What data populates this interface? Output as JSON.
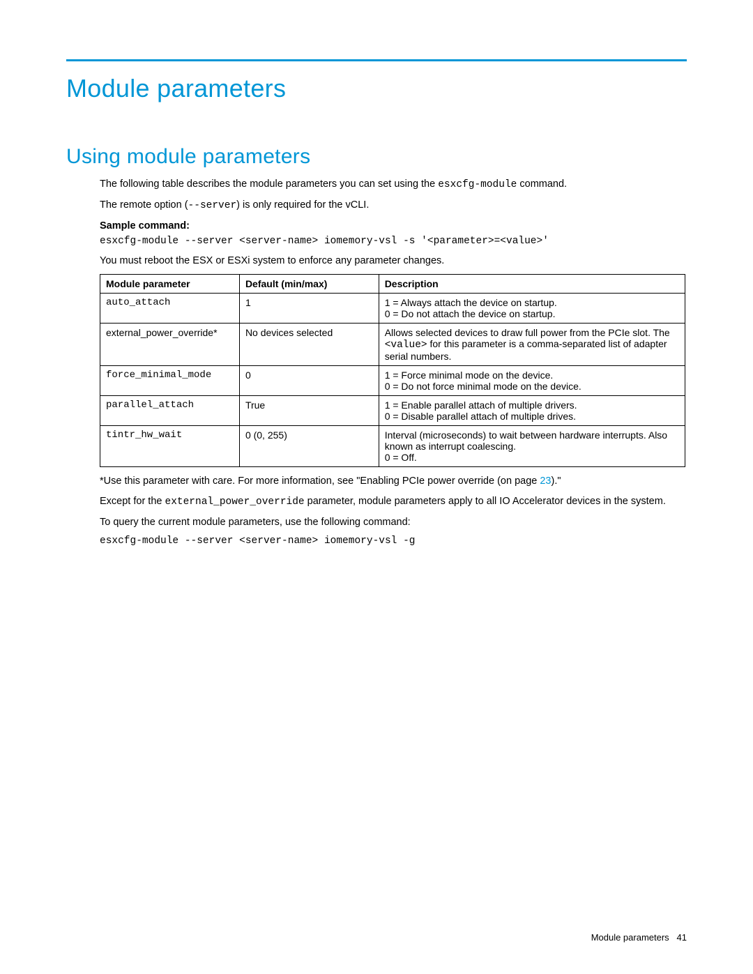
{
  "page_title": "Module parameters",
  "section_heading": "Using module parameters",
  "intro_text_1_pre": "The following table describes the module parameters you can set using the ",
  "intro_text_1_cmd": "esxcfg-module",
  "intro_text_1_post": " command.",
  "intro_text_2_pre": "The remote option (",
  "intro_text_2_cmd": "--server",
  "intro_text_2_post": ") is only required for the vCLI.",
  "sample_label": "Sample command:",
  "sample_cmd": "esxcfg-module --server <server-name> iomemory-vsl -s '<parameter>=<value>'",
  "reboot_note": "You must reboot the ESX or ESXi system to enforce any parameter changes.",
  "table": {
    "headers": {
      "param": "Module parameter",
      "default": "Default (min/max)",
      "desc": "Description"
    },
    "rows": [
      {
        "param": "auto_attach",
        "param_mono": true,
        "default": "1",
        "desc_lines": [
          "1 = Always attach the device on startup.",
          "0 = Do not attach the device on startup."
        ]
      },
      {
        "param": "external_power_override*",
        "param_mono": false,
        "default": "No devices selected",
        "desc_lines_html": "Allows selected devices to draw full power from the PCIe slot. The <span class=\"mono\">&lt;value&gt;</span> for this parameter is a comma-separated list of adapter serial numbers."
      },
      {
        "param": "force_minimal_mode",
        "param_mono": true,
        "default": "0",
        "desc_lines": [
          "1 = Force minimal mode on the device.",
          "0 = Do not force minimal mode on the device."
        ]
      },
      {
        "param": "parallel_attach",
        "param_mono": true,
        "default": "True",
        "desc_lines": [
          "1 = Enable parallel attach of multiple drivers.",
          "0 = Disable parallel attach of multiple drives."
        ]
      },
      {
        "param": "tintr_hw_wait",
        "param_mono": true,
        "default": "0 (0, 255)",
        "desc_lines": [
          "Interval (microseconds) to wait between hardware interrupts. Also known as interrupt coalescing.",
          "0 = Off."
        ]
      }
    ]
  },
  "footnote_pre": "*Use this parameter with care. For more information, see \"Enabling PCIe power override (on page ",
  "footnote_link": "23",
  "footnote_post": ").\"",
  "except_text_pre": "Except for the ",
  "except_text_cmd": "external_power_override",
  "except_text_post": " parameter, module parameters apply to all IO Accelerator devices in the system.",
  "query_text": "To query the current module parameters, use the following command:",
  "query_cmd": "esxcfg-module --server <server-name> iomemory-vsl -g",
  "footer_label": "Module parameters",
  "footer_page": "41"
}
